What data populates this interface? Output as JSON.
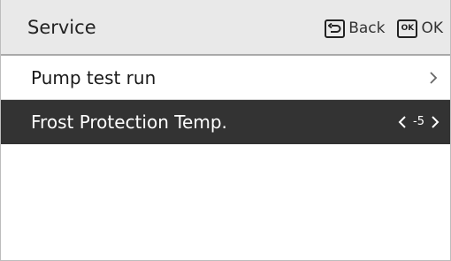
{
  "header": {
    "title": "Service",
    "back_label": "Back",
    "ok_label": "OK",
    "ok_icon_text": "OK"
  },
  "menu": {
    "items": [
      {
        "label": "Pump test run"
      },
      {
        "label": "Frost Protection Temp.",
        "value": "-5"
      }
    ]
  },
  "colors": {
    "header_bg": "#e9e9e9",
    "selected_row_bg": "#333333",
    "text": "#1a1a1a"
  }
}
